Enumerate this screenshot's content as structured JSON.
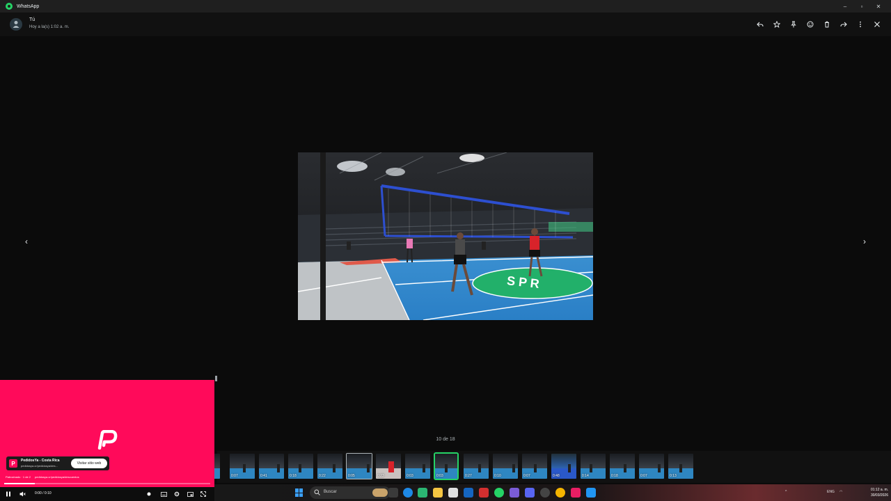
{
  "app": {
    "title": "WhatsApp"
  },
  "window_controls": {
    "minimize": "–",
    "maximize": "▫",
    "close": "✕"
  },
  "header": {
    "sender": "Tú",
    "timestamp": "Hoy a la(s) 1:02 a. m.",
    "actions": [
      "reply-icon",
      "star-icon",
      "pin-icon",
      "emoji-icon",
      "delete-icon",
      "forward-icon",
      "more-icon",
      "close-icon"
    ]
  },
  "viewer": {
    "prev": "‹",
    "next": "›",
    "counter": "10 de 18"
  },
  "thumbnails": [
    {
      "duration": ""
    },
    {
      "duration": "0:07"
    },
    {
      "duration": "0:41"
    },
    {
      "duration": "0:18"
    },
    {
      "duration": "0:22"
    },
    {
      "duration": "0:05"
    },
    {
      "duration": "0:23"
    },
    {
      "duration": "0:03"
    },
    {
      "duration": "0:03"
    },
    {
      "duration": "0:27"
    },
    {
      "duration": "0:10"
    },
    {
      "duration": "0:07"
    },
    {
      "duration": "0:48"
    },
    {
      "duration": "0:14"
    },
    {
      "duration": "0:18"
    },
    {
      "duration": "0:07"
    },
    {
      "duration": "0:13"
    }
  ],
  "selected_thumbnail": 8,
  "mini_player": {
    "ad_title": "PedidosYa - Costa Rica",
    "ad_url": "pedidosya.cr/pedidosya/des...",
    "visit_label": "Visitar sitio web",
    "sponsor_label": "Patrocinado · 1 de 2",
    "sponsor_url": "pedidosya.cr/pedidosya/descuentos",
    "time": "0:00 / 0:10",
    "progress": 0.15,
    "accent": "#ff0a5a"
  },
  "taskbar": {
    "search_placeholder": "Buscar",
    "tray_lang": "ENG",
    "clock_time": "01:12 a. m.",
    "clock_date": "30/03/2026"
  },
  "colors": {
    "whatsapp_green": "#25d366",
    "background": "#0b0b0b"
  }
}
